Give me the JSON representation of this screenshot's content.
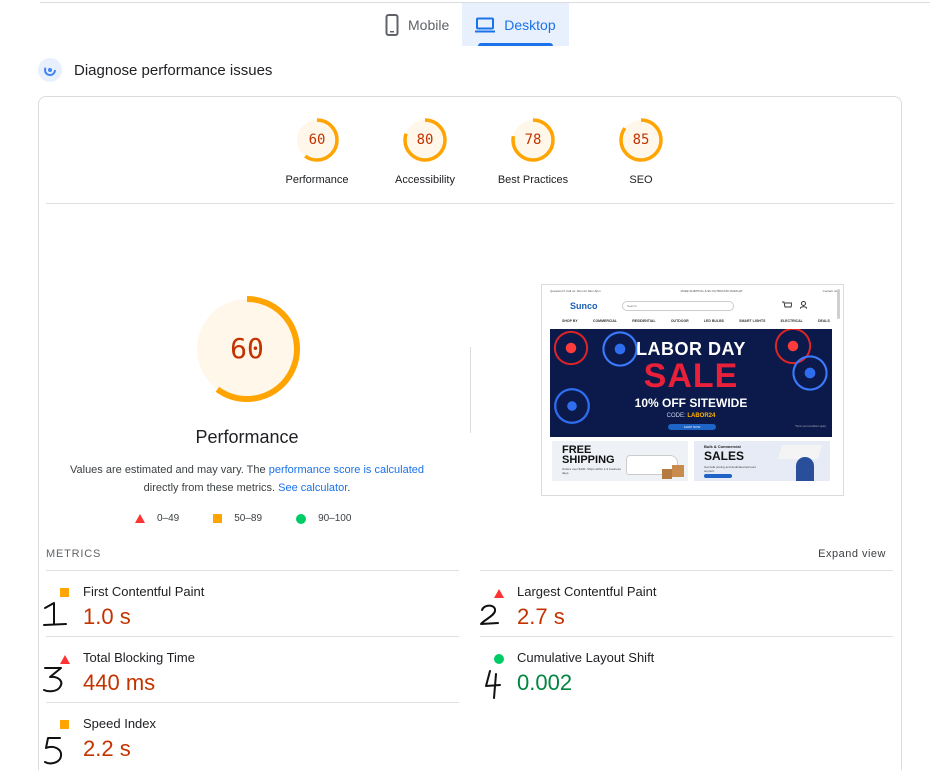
{
  "tabs": [
    {
      "label": "Mobile",
      "icon": "smartphone-icon",
      "active": false
    },
    {
      "label": "Desktop",
      "icon": "laptop-icon",
      "active": true
    }
  ],
  "diagnose": {
    "title": "Diagnose performance issues",
    "icon": "pulse-icon"
  },
  "colors": {
    "fail": "#ff3333",
    "average": "#ffa400",
    "pass": "#00cc66",
    "link": "#1a73e8",
    "average_text": "#c33300",
    "pass_text": "#018642"
  },
  "scores": [
    {
      "label": "Performance",
      "value": "60"
    },
    {
      "label": "Accessibility",
      "value": "80"
    },
    {
      "label": "Best Practices",
      "value": "78"
    },
    {
      "label": "SEO",
      "value": "85"
    }
  ],
  "performance": {
    "score": "60",
    "title": "Performance",
    "note_prefix": "Values are estimated and may vary. The ",
    "note_link1": "performance score is calculated",
    "note_middle": " directly from these metrics. ",
    "note_link2": "See calculator",
    "note_suffix": "."
  },
  "legend": [
    {
      "range": "0–49",
      "shape": "triangle"
    },
    {
      "range": "50–89",
      "shape": "square"
    },
    {
      "range": "90–100",
      "shape": "circle"
    }
  ],
  "screenshot": {
    "site_logo": "Sunco",
    "search_placeholder": "Search",
    "topbar_left": "Questions? Call us: Mon-Fri 8am-5pm",
    "topbar_center": "FREE SHIPPING & $0 OUTBOUND FREIGHT",
    "topbar_right": "Contact us",
    "nav": [
      "SHOP BY",
      "COMMERCIAL",
      "RESIDENTIAL",
      "OUTDOOR",
      "LED BULBS",
      "SMART LIGHTS",
      "ELECTRICAL",
      "DEALS"
    ],
    "banner_line1": "LABOR DAY",
    "banner_line2": "SALE",
    "banner_line3": "10% OFF SITEWIDE",
    "banner_code_label": "CODE: ",
    "banner_code": "LABOR24",
    "banner_button": "SHOP NOW",
    "banner_fine": "*Terms and conditions apply",
    "promo1_title_1": "FREE",
    "promo1_title_2": "SHIPPING",
    "promo1_sub": "Orders over $100. Ships within 1-2 business days.",
    "promo2_small": "Bulk & Commercial",
    "promo2_title": "SALES",
    "promo2_sub": "Get bulk pricing and dedicated account support."
  },
  "metrics": {
    "title": "METRICS",
    "expand_label": "Expand view",
    "items": [
      {
        "label": "First Contentful Paint",
        "value": "1.0 s",
        "status": "average"
      },
      {
        "label": "Largest Contentful Paint",
        "value": "2.7 s",
        "status": "fail"
      },
      {
        "label": "Total Blocking Time",
        "value": "440 ms",
        "status": "fail"
      },
      {
        "label": "Cumulative Layout Shift",
        "value": "0.002",
        "status": "pass"
      },
      {
        "label": "Speed Index",
        "value": "2.2 s",
        "status": "average"
      }
    ]
  },
  "annotations": [
    "1",
    "2",
    "3",
    "4",
    "5"
  ]
}
